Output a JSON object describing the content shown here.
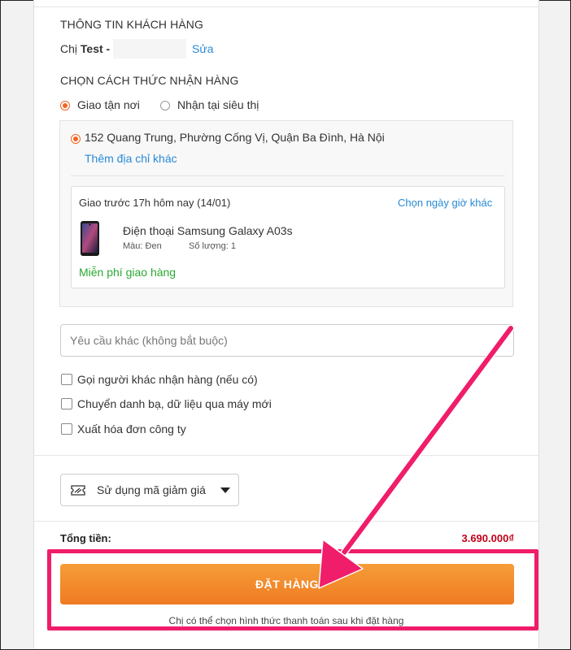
{
  "customer": {
    "section_title": "THÔNG TIN KHÁCH HÀNG",
    "salutation": "Chị",
    "name": "Test -",
    "edit_link": "Sửa"
  },
  "delivery": {
    "section_title": "CHỌN CÁCH THỨC NHẬN HÀNG",
    "options": [
      {
        "label": "Giao tận nơi",
        "selected": true
      },
      {
        "label": "Nhận tại siêu thị",
        "selected": false
      }
    ],
    "address": "152 Quang Trung, Phường Cống Vị, Quận Ba Đình, Hà Nội",
    "add_address_link": "Thêm địa chỉ khác",
    "shipment": {
      "eta": "Giao trước 17h hôm nay (14/01)",
      "change_time_link": "Chọn ngày giờ khác",
      "product_name": "Điện thoại Samsung Galaxy A03s",
      "color_label": "Màu: Đen",
      "quantity_label": "Số lượng: 1",
      "shipping_fee": "Miễn phí giao hàng"
    }
  },
  "extra_request": {
    "placeholder": "Yêu cầu khác (không bắt buộc)"
  },
  "checkboxes": [
    {
      "label": "Gọi người khác nhận hàng (nếu có)",
      "checked": false
    },
    {
      "label": "Chuyển danh bạ, dữ liệu qua máy mới",
      "checked": false
    },
    {
      "label": "Xuất hóa đơn công ty",
      "checked": false
    }
  ],
  "coupon": {
    "label": "Sử dụng mã giảm giá"
  },
  "total": {
    "label": "Tổng tiền:",
    "value": "3.690.000₫"
  },
  "order": {
    "button_label": "ĐẶT HÀNG",
    "note": "Chị có thể chọn hình thức thanh toán sau khi đặt hàng"
  },
  "colors": {
    "accent_orange": "#f26522",
    "link_blue": "#288ad6",
    "free_ship_green": "#2ba832",
    "price_red": "#c10017",
    "annotation_pink": "#ef1d6a"
  }
}
